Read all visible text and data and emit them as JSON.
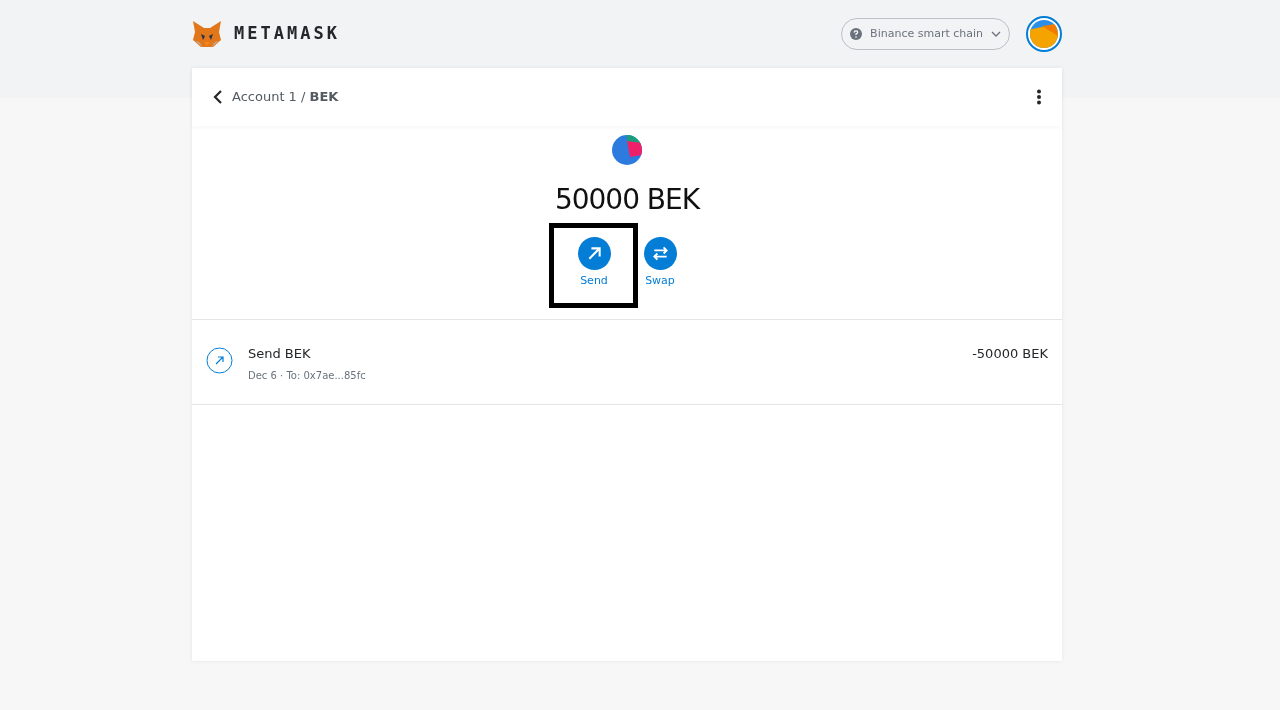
{
  "header": {
    "brand": "METAMASK",
    "network": {
      "label": "Binance smart chain"
    }
  },
  "breadcrumb": "Account 1 / **BEK**",
  "balance": "50000 BEK",
  "actions": [
    {
      "kind": "send",
      "label": "Send",
      "highlighted": true
    },
    {
      "kind": "swap",
      "label": "Swap",
      "highlighted": false
    }
  ],
  "transactions": [
    {
      "title": "Send BEK",
      "subtitle": "Dec 6 · To: 0x7ae...85fc",
      "amount": "-50000 BEK"
    }
  ]
}
